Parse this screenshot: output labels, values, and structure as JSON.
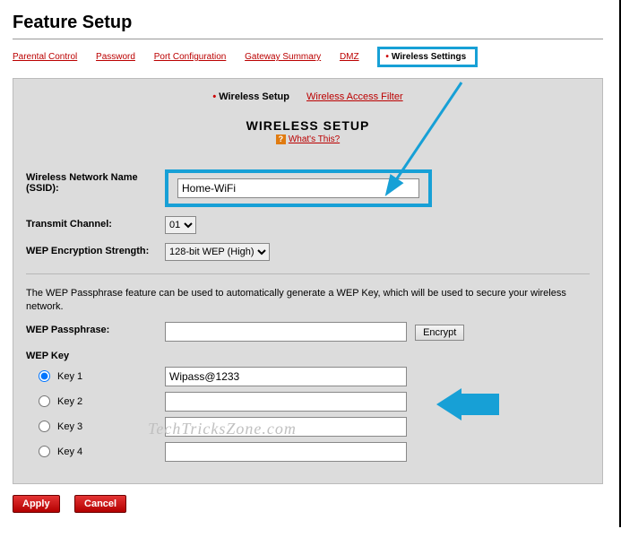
{
  "title": "Feature Setup",
  "nav": {
    "parental": "Parental Control",
    "password": "Password",
    "port": "Port Configuration",
    "gateway": "Gateway Summary",
    "dmz": "DMZ",
    "wireless": "Wireless Settings"
  },
  "subnav": {
    "setup": "Wireless Setup",
    "filter": "Wireless Access Filter"
  },
  "section": {
    "heading": "WIRELESS SETUP",
    "question": "?",
    "whats": "What's This?"
  },
  "labels": {
    "ssid": "Wireless Network Name (SSID):",
    "channel": "Transmit Channel:",
    "wep_strength": "WEP Encryption Strength:",
    "wep_info": "The WEP Passphrase feature can be used to automatically generate a WEP Key, which will be used to secure your wireless network.",
    "wep_passphrase": "WEP Passphrase:",
    "encrypt": "Encrypt",
    "wep_key": "WEP Key",
    "key1": "Key 1",
    "key2": "Key 2",
    "key3": "Key 3",
    "key4": "Key 4"
  },
  "values": {
    "ssid": "Home-WiFi",
    "channel": "01",
    "wep_strength": "128-bit WEP (High)",
    "passphrase": "",
    "key1": "Wipass@1233",
    "key2": "",
    "key3": "",
    "key4": ""
  },
  "buttons": {
    "apply": "Apply",
    "cancel": "Cancel"
  },
  "watermark": "TechTricksZone.com"
}
